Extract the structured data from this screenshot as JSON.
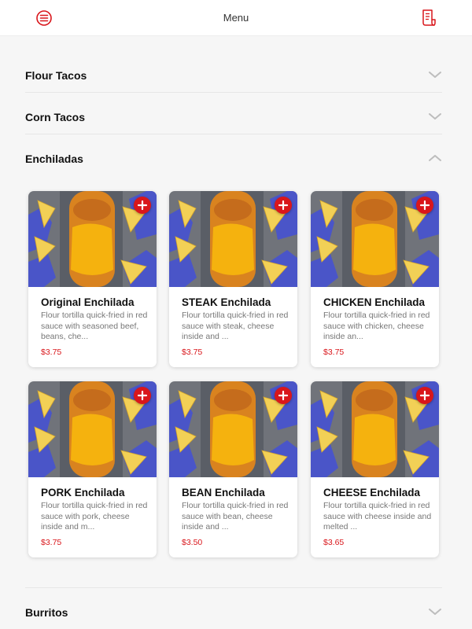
{
  "header": {
    "title": "Menu",
    "menu_icon": "hamburger-circle-icon",
    "receipt_icon": "receipt-icon"
  },
  "theme": {
    "accent": "#d9161b",
    "background": "#f6f6f6"
  },
  "categories": [
    {
      "label": "Flour Tacos",
      "state": "collapsed"
    },
    {
      "label": "Corn Tacos",
      "state": "collapsed"
    },
    {
      "label": "Enchiladas",
      "state": "expanded"
    },
    {
      "label": "Burritos",
      "state": "collapsed"
    }
  ],
  "items": [
    {
      "name": "Original Enchilada",
      "desc": "Flour tortilla quick-fried in red sauce with seasoned beef, beans, che...",
      "price": "$3.75"
    },
    {
      "name": "STEAK Enchilada",
      "desc": "Flour tortilla quick-fried in red sauce with steak, cheese inside and ...",
      "price": "$3.75"
    },
    {
      "name": "CHICKEN Enchilada",
      "desc": "Flour tortilla quick-fried in red sauce with chicken, cheese inside an...",
      "price": "$3.75"
    },
    {
      "name": "PORK Enchilada",
      "desc": "Flour tortilla quick-fried in red sauce with pork, cheese inside and m...",
      "price": "$3.75"
    },
    {
      "name": "BEAN Enchilada",
      "desc": "Flour tortilla quick-fried in red sauce with bean, cheese inside and ...",
      "price": "$3.50"
    },
    {
      "name": "CHEESE Enchilada",
      "desc": "Flour tortilla quick-fried in red sauce with cheese inside and melted ...",
      "price": "$3.65"
    }
  ]
}
